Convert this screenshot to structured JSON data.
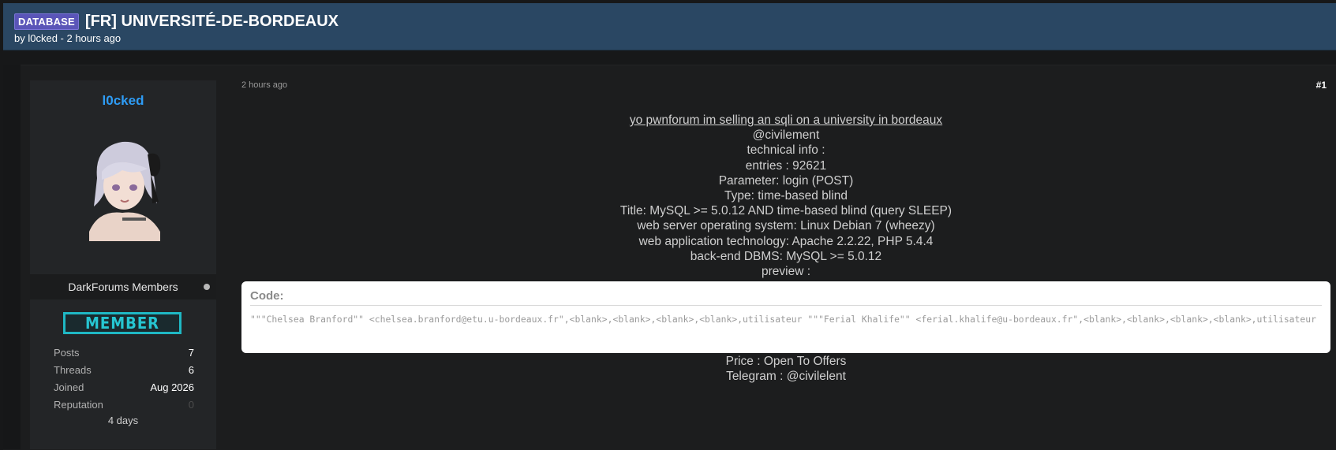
{
  "thread": {
    "tag": "DATABASE",
    "title": "[FR] UNIVERSITÉ-DE-BORDEAUX",
    "byline": "by l0cked - 2 hours ago"
  },
  "author": {
    "username": "l0cked",
    "group": "DarkForums Members",
    "badge": "MEMBER",
    "stats": [
      {
        "label": "Posts",
        "value": "7"
      },
      {
        "label": "Threads",
        "value": "6"
      },
      {
        "label": "Joined",
        "value": "Aug 2026"
      },
      {
        "label": "Reputation",
        "value": "0"
      }
    ],
    "extra": "4 days"
  },
  "post": {
    "time": "2 hours ago",
    "number": "#1",
    "lines": [
      "yo pwnforum im selling an sqli on a university in bordeaux ",
      "@civilement",
      "technical info :",
      "entries : 92621",
      "Parameter: login (POST)",
      "Type: time-based blind",
      "Title: MySQL >= 5.0.12 AND time-based blind (query SLEEP)",
      "web server operating system: Linux Debian 7 (wheezy)",
      "web application technology: Apache 2.2.22, PHP 5.4.4",
      "back-end DBMS: MySQL >= 5.0.12",
      "preview :"
    ],
    "code_title": "Code:",
    "code_text": "\"\"\"Chelsea Branford\"\" <chelsea.branford@etu.u-bordeaux.fr\",<blank>,<blank>,<blank>,<blank>,utilisateur \"\"\"Ferial Khalife\"\" <ferial.khalife@u-bordeaux.fr\",<blank>,<blank>,<blank>,<blank>,utilisateur",
    "footer_lines": [
      "Price : Open To Offers",
      "Telegram : @civilelent"
    ]
  },
  "colors": {
    "header_bg": "#2a4763",
    "username": "#2e9cf5",
    "badge": "#1fb8c4",
    "tag_bg": "#5a55b8"
  }
}
